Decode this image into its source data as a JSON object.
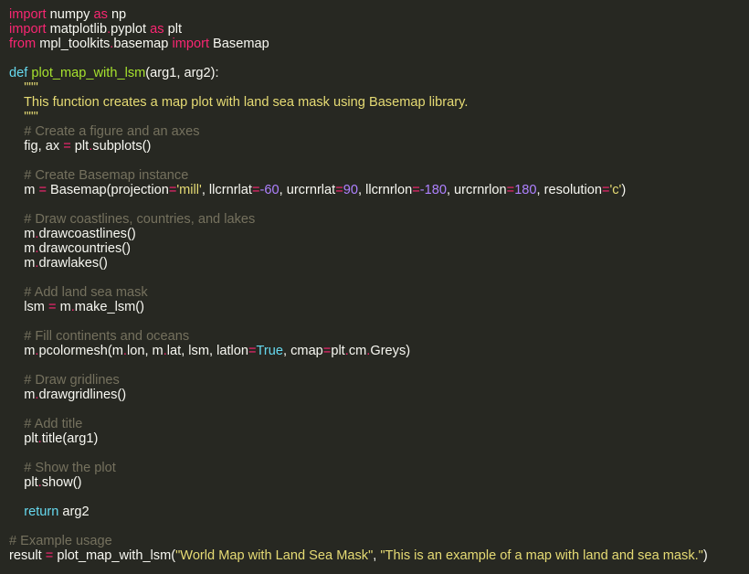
{
  "editor": {
    "language": "python",
    "theme_colors": {
      "background": "#272822",
      "text": "#f8f8f2",
      "keyword": "#f92672",
      "def_keyword": "#66d9ef",
      "function_name": "#a6e22e",
      "string": "#e6db74",
      "comment": "#75715e",
      "number": "#ae81ff",
      "constant": "#66d9ef"
    },
    "lines": [
      [
        [
          "kw",
          "import"
        ],
        [
          "text",
          " numpy "
        ],
        [
          "kw",
          "as"
        ],
        [
          "text",
          " np"
        ]
      ],
      [
        [
          "kw",
          "import"
        ],
        [
          "text",
          " matplotlib"
        ],
        [
          "op",
          "."
        ],
        [
          "text",
          "pyplot "
        ],
        [
          "kw",
          "as"
        ],
        [
          "text",
          " plt"
        ]
      ],
      [
        [
          "kw",
          "from"
        ],
        [
          "text",
          " mpl_toolkits"
        ],
        [
          "op",
          "."
        ],
        [
          "text",
          "basemap "
        ],
        [
          "kw",
          "import"
        ],
        [
          "text",
          " Basemap"
        ]
      ],
      [],
      [
        [
          "def",
          "def"
        ],
        [
          "text",
          " "
        ],
        [
          "fn",
          "plot_map_with_lsm"
        ],
        [
          "text",
          "(arg1, arg2):"
        ]
      ],
      [
        [
          "str",
          "    \"\"\""
        ]
      ],
      [
        [
          "str",
          "    This function creates a map plot with land sea mask using Basemap library."
        ]
      ],
      [
        [
          "str",
          "    \"\"\""
        ]
      ],
      [
        [
          "cmt",
          "    # Create a figure and an axes"
        ]
      ],
      [
        [
          "text",
          "    fig, ax "
        ],
        [
          "op",
          "="
        ],
        [
          "text",
          " plt"
        ],
        [
          "op",
          "."
        ],
        [
          "text",
          "subplots()"
        ]
      ],
      [],
      [
        [
          "cmt",
          "    # Create Basemap instance"
        ]
      ],
      [
        [
          "text",
          "    m "
        ],
        [
          "op",
          "="
        ],
        [
          "text",
          " Basemap(projection"
        ],
        [
          "op",
          "="
        ],
        [
          "str",
          "'mill'"
        ],
        [
          "text",
          ", llcrnrlat"
        ],
        [
          "op",
          "="
        ],
        [
          "num",
          "-60"
        ],
        [
          "text",
          ", urcrnrlat"
        ],
        [
          "op",
          "="
        ],
        [
          "num",
          "90"
        ],
        [
          "text",
          ", llcrnrlon"
        ],
        [
          "op",
          "="
        ],
        [
          "num",
          "-180"
        ],
        [
          "text",
          ", urcrnrlon"
        ],
        [
          "op",
          "="
        ],
        [
          "num",
          "180"
        ],
        [
          "text",
          ", resolution"
        ],
        [
          "op",
          "="
        ],
        [
          "str",
          "'c'"
        ],
        [
          "text",
          ")"
        ]
      ],
      [],
      [
        [
          "cmt",
          "    # Draw coastlines, countries, and lakes"
        ]
      ],
      [
        [
          "text",
          "    m"
        ],
        [
          "op",
          "."
        ],
        [
          "text",
          "drawcoastlines()"
        ]
      ],
      [
        [
          "text",
          "    m"
        ],
        [
          "op",
          "."
        ],
        [
          "text",
          "drawcountries()"
        ]
      ],
      [
        [
          "text",
          "    m"
        ],
        [
          "op",
          "."
        ],
        [
          "text",
          "drawlakes()"
        ]
      ],
      [],
      [
        [
          "cmt",
          "    # Add land sea mask"
        ]
      ],
      [
        [
          "text",
          "    lsm "
        ],
        [
          "op",
          "="
        ],
        [
          "text",
          " m"
        ],
        [
          "op",
          "."
        ],
        [
          "text",
          "make_lsm()"
        ]
      ],
      [],
      [
        [
          "cmt",
          "    # Fill continents and oceans"
        ]
      ],
      [
        [
          "text",
          "    m"
        ],
        [
          "op",
          "."
        ],
        [
          "text",
          "pcolormesh(m"
        ],
        [
          "op",
          "."
        ],
        [
          "text",
          "lon, m"
        ],
        [
          "op",
          "."
        ],
        [
          "text",
          "lat, lsm, latlon"
        ],
        [
          "op",
          "="
        ],
        [
          "const",
          "True"
        ],
        [
          "text",
          ", cmap"
        ],
        [
          "op",
          "="
        ],
        [
          "text",
          "plt"
        ],
        [
          "op",
          "."
        ],
        [
          "text",
          "cm"
        ],
        [
          "op",
          "."
        ],
        [
          "text",
          "Greys)"
        ]
      ],
      [],
      [
        [
          "cmt",
          "    # Draw gridlines"
        ]
      ],
      [
        [
          "text",
          "    m"
        ],
        [
          "op",
          "."
        ],
        [
          "text",
          "drawgridlines()"
        ]
      ],
      [],
      [
        [
          "cmt",
          "    # Add title"
        ]
      ],
      [
        [
          "text",
          "    plt"
        ],
        [
          "op",
          "."
        ],
        [
          "text",
          "title(arg1)"
        ]
      ],
      [],
      [
        [
          "cmt",
          "    # Show the plot"
        ]
      ],
      [
        [
          "text",
          "    plt"
        ],
        [
          "op",
          "."
        ],
        [
          "text",
          "show()"
        ]
      ],
      [],
      [
        [
          "text",
          "    "
        ],
        [
          "def",
          "return"
        ],
        [
          "text",
          " arg2"
        ]
      ],
      [],
      [
        [
          "cmt",
          "# Example usage"
        ]
      ],
      [
        [
          "text",
          "result "
        ],
        [
          "op",
          "="
        ],
        [
          "text",
          " plot_map_with_lsm("
        ],
        [
          "str",
          "\"World Map with Land Sea Mask\""
        ],
        [
          "text",
          ", "
        ],
        [
          "str",
          "\"This is an example of a map with land and sea mask.\""
        ],
        [
          "text",
          ")"
        ]
      ]
    ]
  }
}
